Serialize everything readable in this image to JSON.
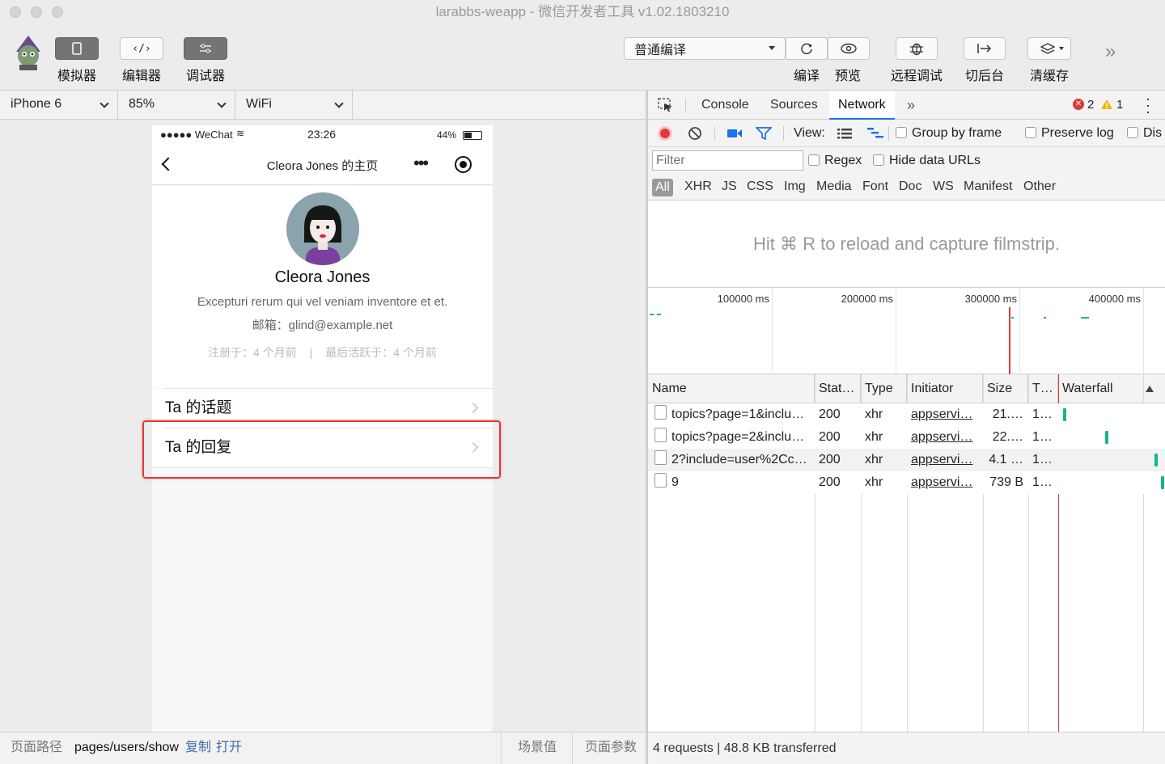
{
  "window": {
    "title": "larabbs-weapp - 微信开发者工具 v1.02.1803210"
  },
  "toolbar": {
    "simulator": "模拟器",
    "editor": "编辑器",
    "debugger": "调试器",
    "compile_mode": "普通编译",
    "compile": "编译",
    "preview": "预览",
    "remote_debug": "远程调试",
    "background": "切后台",
    "clear_cache": "清缓存"
  },
  "device_bar": {
    "device": "iPhone 6",
    "zoom": "85%",
    "network": "WiFi"
  },
  "phone": {
    "status": {
      "carrier": "●●●●● WeChat",
      "time": "23:26",
      "battery": "44%"
    },
    "nav_title": "Cleora Jones 的主页",
    "profile": {
      "name": "Cleora Jones",
      "bio": "Excepturi rerum qui vel veniam inventore et et.",
      "email": "邮箱：glind@example.net",
      "registered": "注册于：4 个月前",
      "separator": "|",
      "last_active": "最后活跃于：4 个月前"
    },
    "menu": [
      {
        "label": "Ta 的话题"
      },
      {
        "label": "Ta 的回复"
      }
    ]
  },
  "bottom_bar": {
    "path_label": "页面路径",
    "path": "pages/users/show",
    "copy": "复制",
    "open": "打开",
    "scene": "场景值",
    "params": "页面参数"
  },
  "devtools": {
    "tabs": [
      "Console",
      "Sources",
      "Network"
    ],
    "active_tab": "Network",
    "errors": "2",
    "warnings": "1",
    "view_label": "View:",
    "group_by_frame": "Group by frame",
    "preserve_log": "Preserve log",
    "disable_cache": "Dis",
    "filter_placeholder": "Filter",
    "regex": "Regex",
    "hide_data_urls": "Hide data URLs",
    "types": [
      "All",
      "XHR",
      "JS",
      "CSS",
      "Img",
      "Media",
      "Font",
      "Doc",
      "WS",
      "Manifest",
      "Other"
    ],
    "filmstrip_hint": "Hit ⌘ R to reload and capture filmstrip.",
    "timeline_ticks": [
      "100000 ms",
      "200000 ms",
      "300000 ms",
      "400000 ms"
    ],
    "columns": [
      "Name",
      "Stat…",
      "Type",
      "Initiator",
      "Size",
      "T…",
      "Waterfall"
    ],
    "requests": [
      {
        "name": "topics?page=1&inclu…",
        "status": "200",
        "type": "xhr",
        "initiator": "appservi…",
        "size": "21.…",
        "time": "1…"
      },
      {
        "name": "topics?page=2&inclu…",
        "status": "200",
        "type": "xhr",
        "initiator": "appservi…",
        "size": "22.…",
        "time": "1…"
      },
      {
        "name": "2?include=user%2Cc…",
        "status": "200",
        "type": "xhr",
        "initiator": "appservi…",
        "size": "4.1 …",
        "time": "1…"
      },
      {
        "name": "9",
        "status": "200",
        "type": "xhr",
        "initiator": "appservi…",
        "size": "739 B",
        "time": "1…"
      }
    ],
    "summary": "4 requests | 48.8 KB transferred"
  },
  "colors": {
    "accent_red": "#e0393b",
    "waterfall_green": "#14b68a",
    "link_blue": "#3f6ab3",
    "avatar_bg": "#8ba3ad",
    "shirt": "#7c3f9e"
  }
}
